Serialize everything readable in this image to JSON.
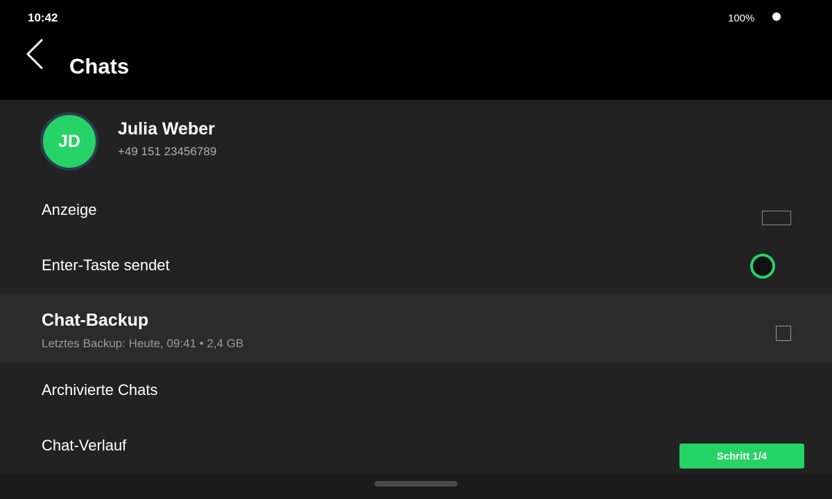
{
  "status_bar": {
    "time": "10:42",
    "battery": "100%"
  },
  "header": {
    "title": "Chats",
    "back_icon": "chevron-left-icon"
  },
  "profile": {
    "initials": "JD",
    "name": "Julia Weber",
    "phone": "+49 151 23456789",
    "avatar_color": "#25d366"
  },
  "settings": {
    "anzeige": {
      "label": "Anzeige"
    },
    "enter_key": {
      "label": "Enter-Taste sendet",
      "checked": false
    },
    "backup": {
      "title": "Chat-Backup",
      "subtitle": "Letztes Backup: Heute, 09:41 • 2,4 GB",
      "checked": false
    },
    "archived": {
      "label": "Archivierte Chats"
    },
    "history": {
      "label": "Chat-Verlauf"
    }
  },
  "step_button": {
    "label": "Schritt 1/4"
  },
  "colors": {
    "accent": "#25d366",
    "background": "#222222",
    "highlight": "#2b2b2b",
    "header": "#000000"
  }
}
